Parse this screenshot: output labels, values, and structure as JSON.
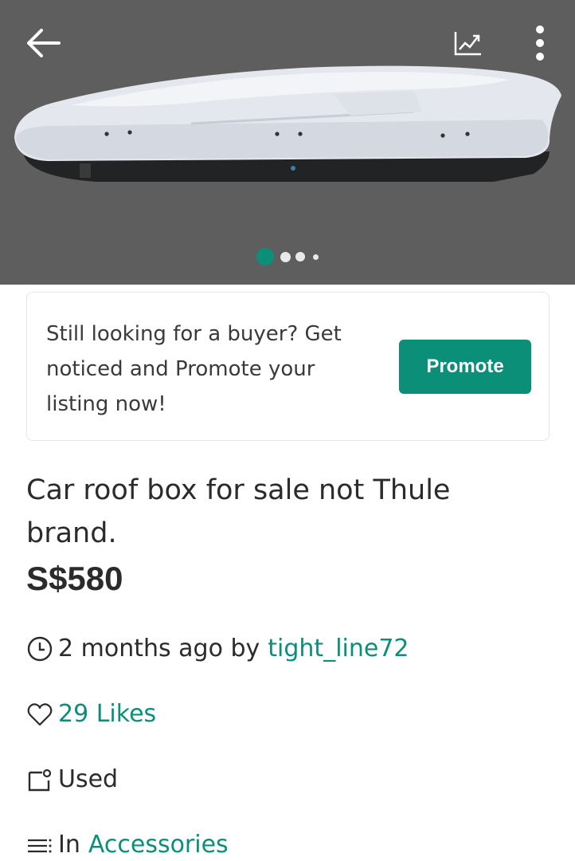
{
  "header": {
    "icons": [
      "arrow-left-icon",
      "trend-chart-icon",
      "more-vertical-icon"
    ],
    "carousel": {
      "total": 4,
      "active_index": 0
    }
  },
  "promo": {
    "text_line1": "Still looking for a buyer? Get",
    "text_line2": "noticed and Promote your",
    "text_line3": "listing now!",
    "button_label": "Promote"
  },
  "listing": {
    "title_line1": "Car roof box for sale not Thule",
    "title_line2": "brand.",
    "price": "S$580",
    "posted_time": "2 months ago by",
    "seller": "tight_line72",
    "likes": "29 Likes",
    "condition": "Used",
    "category_prefix": "In",
    "category": "Accessories"
  },
  "colors": {
    "accent": "#0b8f79",
    "hero_bg": "#5d5e5d",
    "text": "#2b2b2b"
  }
}
